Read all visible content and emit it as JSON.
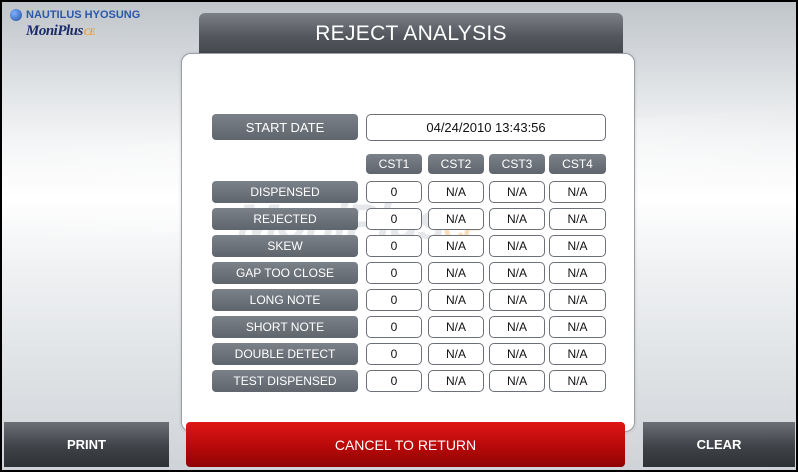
{
  "logo": {
    "brand_top": "NAUTILUS HYOSUNG",
    "brand_bottom": "MoniPlus",
    "brand_suffix": "CE"
  },
  "title": "REJECT ANALYSIS",
  "start_date": {
    "label": "START DATE",
    "value": "04/24/2010 13:43:56"
  },
  "columns": [
    "CST1",
    "CST2",
    "CST3",
    "CST4"
  ],
  "rows": [
    {
      "label": "DISPENSED",
      "values": [
        "0",
        "N/A",
        "N/A",
        "N/A"
      ]
    },
    {
      "label": "REJECTED",
      "values": [
        "0",
        "N/A",
        "N/A",
        "N/A"
      ]
    },
    {
      "label": "SKEW",
      "values": [
        "0",
        "N/A",
        "N/A",
        "N/A"
      ]
    },
    {
      "label": "GAP TOO CLOSE",
      "values": [
        "0",
        "N/A",
        "N/A",
        "N/A"
      ]
    },
    {
      "label": "LONG NOTE",
      "values": [
        "0",
        "N/A",
        "N/A",
        "N/A"
      ]
    },
    {
      "label": "SHORT NOTE",
      "values": [
        "0",
        "N/A",
        "N/A",
        "N/A"
      ]
    },
    {
      "label": "DOUBLE DETECT",
      "values": [
        "0",
        "N/A",
        "N/A",
        "N/A"
      ]
    },
    {
      "label": "TEST DISPENSED",
      "values": [
        "0",
        "N/A",
        "N/A",
        "N/A"
      ]
    }
  ],
  "buttons": {
    "print": "PRINT",
    "cancel": "CANCEL TO RETURN",
    "clear": "CLEAR"
  },
  "colors": {
    "cancel_red": "#c80b0b",
    "label_gray": "#6b7179",
    "title_dark": "#4b4f55"
  }
}
